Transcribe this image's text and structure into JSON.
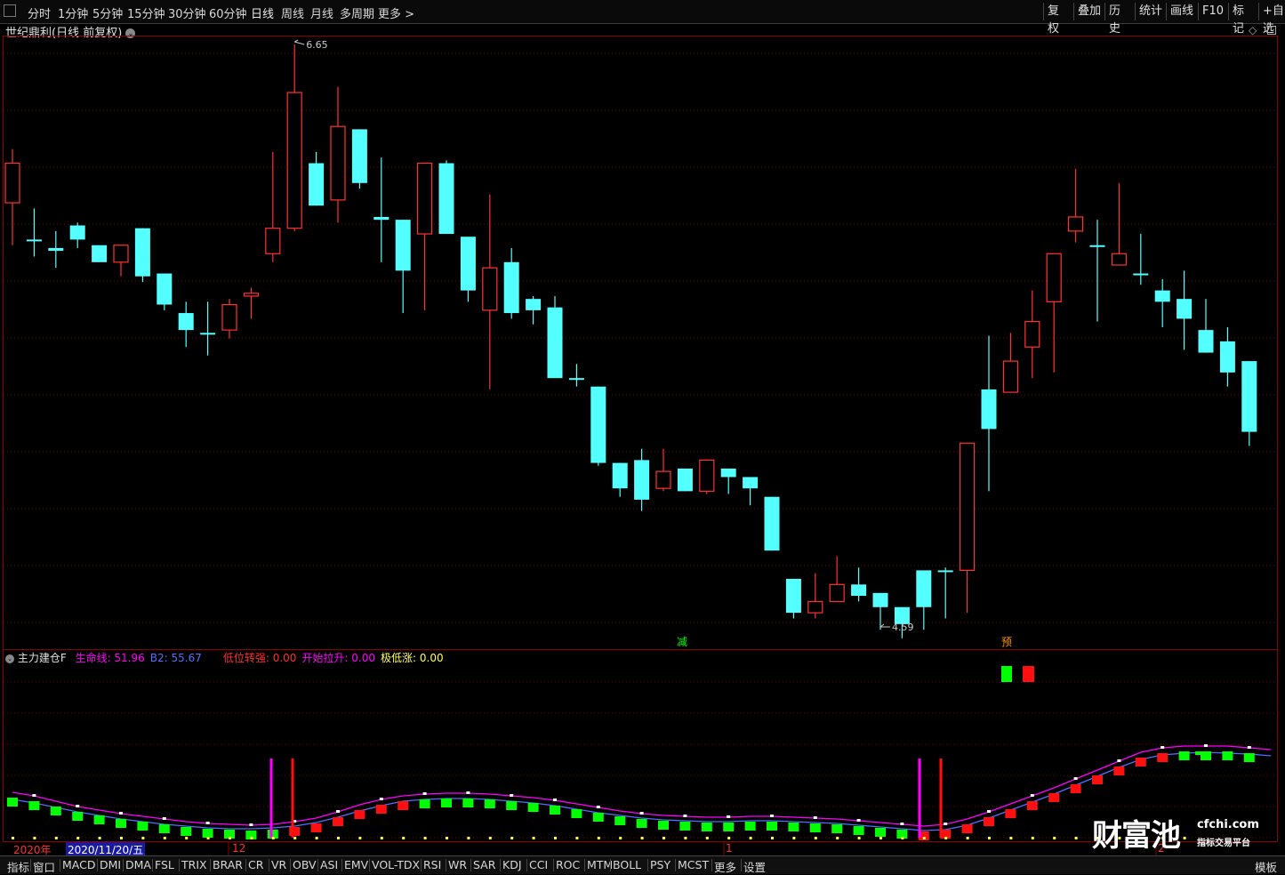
{
  "toolbar": {
    "periods": [
      "分时",
      "1分钟",
      "5分钟",
      "15分钟",
      "30分钟",
      "60分钟",
      "日线",
      "周线",
      "月线",
      "多周期",
      "更多 >"
    ],
    "active_period": "日线",
    "right_buttons": [
      "复权",
      "叠加",
      "历史",
      "统计",
      "画线",
      "F10",
      "标记",
      "+自选"
    ]
  },
  "chart": {
    "title": "世纪鼎利(日线 前复权)",
    "high_label": "6.65",
    "low_label": "4.59",
    "sig_jian": "减",
    "sig_yu": "预",
    "up_color": "#ff3232",
    "down_color": "#54ffff"
  },
  "indicator": {
    "name": "主力建仓F",
    "items": [
      {
        "label": "生命线: 51.96",
        "color": "#ff00ff"
      },
      {
        "label": "B2: 55.67",
        "color": "#5070ff"
      },
      {
        "label": "低位转强: 0.00",
        "color": "#ff3030"
      },
      {
        "label": "开始拉升: 0.00",
        "color": "#ff00ff"
      },
      {
        "label": "极低涨: 0.00",
        "color": "#ffff60"
      }
    ]
  },
  "dates": {
    "year": "2020年",
    "selected": "2020/11/20/五",
    "m12": "12",
    "m1": "1",
    "m2": "2"
  },
  "bottombar": [
    "指标",
    "窗口",
    "MACD",
    "DMI",
    "DMA",
    "FSL",
    "TRIX",
    "BRAR",
    "CR",
    "VR",
    "OBV",
    "ASI",
    "EMV",
    "VOL-TDX",
    "RSI",
    "WR",
    "SAR",
    "KDJ",
    "CCI",
    "ROC",
    "MTM",
    "BOLL",
    "PSY",
    "MCST",
    "更多",
    "设置"
  ],
  "bottom_right": "模板",
  "watermark": {
    "brand": "财富池",
    "site": "cfchi.com",
    "tagline": "指标交易平台"
  },
  "chart_data": {
    "type": "candlestick",
    "candles": [
      [
        6.09,
        6.23,
        5.94,
        6.28
      ],
      [
        5.96,
        5.96,
        5.9,
        6.07
      ],
      [
        5.93,
        5.92,
        5.86,
        5.99
      ],
      [
        6.01,
        5.96,
        5.93,
        6.02
      ],
      [
        5.94,
        5.88,
        5.88,
        5.94
      ],
      [
        5.88,
        5.94,
        5.83,
        5.94
      ],
      [
        6.0,
        5.83,
        5.81,
        6.0
      ],
      [
        5.84,
        5.73,
        5.71,
        5.84
      ],
      [
        5.7,
        5.64,
        5.58,
        5.74
      ],
      [
        5.63,
        5.63,
        5.55,
        5.74
      ],
      [
        5.64,
        5.73,
        5.61,
        5.75
      ],
      [
        5.76,
        5.77,
        5.68,
        5.79
      ],
      [
        5.91,
        6.0,
        5.88,
        6.27
      ],
      [
        6.0,
        6.48,
        5.99,
        6.65
      ],
      [
        6.23,
        6.08,
        6.08,
        6.27
      ],
      [
        6.1,
        6.36,
        6.02,
        6.5
      ],
      [
        6.35,
        6.16,
        6.14,
        6.35
      ],
      [
        6.04,
        6.03,
        5.88,
        6.25
      ],
      [
        6.03,
        5.85,
        5.7,
        6.03
      ],
      [
        5.98,
        6.23,
        5.71,
        6.23
      ],
      [
        6.23,
        5.98,
        5.98,
        6.24
      ],
      [
        5.97,
        5.78,
        5.74,
        5.97
      ],
      [
        5.71,
        5.86,
        5.43,
        6.12
      ],
      [
        5.88,
        5.7,
        5.68,
        5.93
      ],
      [
        5.75,
        5.71,
        5.66,
        5.76
      ],
      [
        5.72,
        5.47,
        5.47,
        5.76
      ],
      [
        5.47,
        5.47,
        5.44,
        5.52
      ],
      [
        5.44,
        5.17,
        5.16,
        5.44
      ],
      [
        5.17,
        5.08,
        5.05,
        5.17
      ],
      [
        5.18,
        5.04,
        5.0,
        5.22
      ],
      [
        5.08,
        5.14,
        5.07,
        5.22
      ],
      [
        5.15,
        5.07,
        5.07,
        5.15
      ],
      [
        5.07,
        5.18,
        5.06,
        5.17
      ],
      [
        5.15,
        5.12,
        5.06,
        5.15
      ],
      [
        5.12,
        5.08,
        5.02,
        5.12
      ],
      [
        5.05,
        4.86,
        4.86,
        5.05
      ],
      [
        4.76,
        4.64,
        4.62,
        4.76
      ],
      [
        4.64,
        4.68,
        4.62,
        4.78
      ],
      [
        4.68,
        4.74,
        4.69,
        4.84
      ],
      [
        4.74,
        4.7,
        4.68,
        4.8
      ],
      [
        4.71,
        4.66,
        4.58,
        4.71
      ],
      [
        4.66,
        4.6,
        4.55,
        4.66
      ],
      [
        4.79,
        4.66,
        4.58,
        4.79
      ],
      [
        4.79,
        4.79,
        4.62,
        4.8
      ],
      [
        4.79,
        5.24,
        4.64,
        5.24
      ],
      [
        5.43,
        5.29,
        5.07,
        5.62
      ],
      [
        5.42,
        5.53,
        5.42,
        5.63
      ],
      [
        5.58,
        5.67,
        5.47,
        5.78
      ],
      [
        5.74,
        5.91,
        5.49,
        5.91
      ],
      [
        5.99,
        6.04,
        5.95,
        6.21
      ],
      [
        5.94,
        5.94,
        5.67,
        6.03
      ],
      [
        5.87,
        5.91,
        5.87,
        6.16
      ],
      [
        5.84,
        5.84,
        5.8,
        5.98
      ],
      [
        5.78,
        5.74,
        5.65,
        5.82
      ],
      [
        5.75,
        5.68,
        5.57,
        5.85
      ],
      [
        5.64,
        5.56,
        5.56,
        5.75
      ],
      [
        5.6,
        5.49,
        5.44,
        5.65
      ],
      [
        5.53,
        5.28,
        5.23,
        5.53
      ]
    ]
  }
}
